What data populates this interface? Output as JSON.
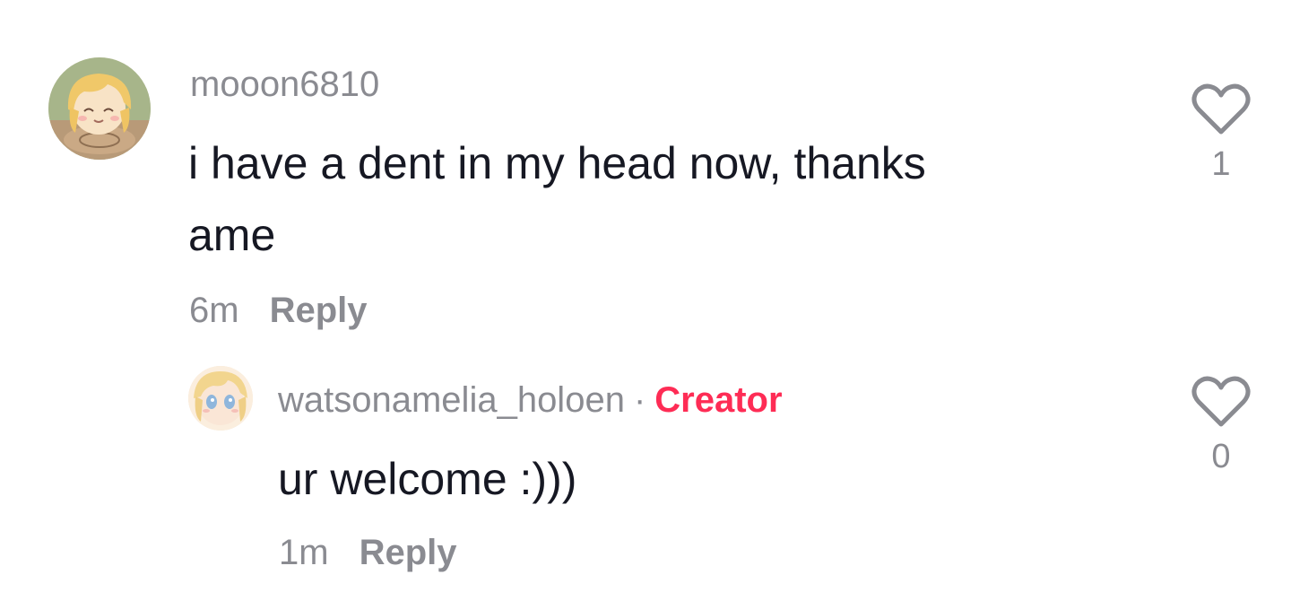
{
  "comments": [
    {
      "username": "mooon6810",
      "text_line1": "i have a dent in my head now, thanks",
      "text_line2": "ame",
      "time": "6m",
      "reply_label": "Reply",
      "likes": "1",
      "avatar_icon": "anime-blonde-girl-avatar"
    }
  ],
  "replies": [
    {
      "username": "watsonamelia_holoen",
      "separator": "·",
      "badge": "Creator",
      "text": "ur welcome :)))",
      "time": "1m",
      "reply_label": "Reply",
      "likes": "0",
      "avatar_icon": "anime-blonde-blue-eyes-avatar"
    }
  ],
  "colors": {
    "text": "#161823",
    "muted": "#8a8b91",
    "creator": "#fe2c55",
    "background": "#ffffff"
  },
  "icons": {
    "like": "heart-outline-icon"
  }
}
